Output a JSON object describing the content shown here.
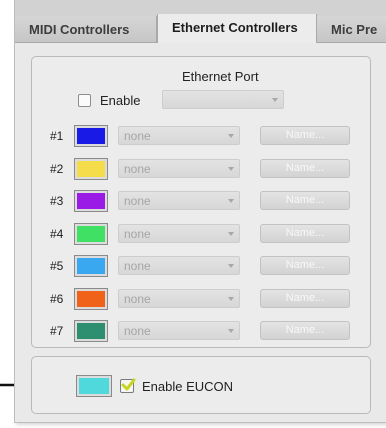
{
  "tabs": [
    {
      "label": "MIDI Controllers",
      "active": false
    },
    {
      "label": "Ethernet Controllers",
      "active": true
    },
    {
      "label": "Mic Pre",
      "active": false
    }
  ],
  "ethernet_port": {
    "label": "Ethernet Port",
    "enable_label": "Enable",
    "enable_checked": false,
    "selected_value": ""
  },
  "controllers": [
    {
      "number": "#1",
      "color": "#1a1ae6",
      "device": "none",
      "name_button": "Name..."
    },
    {
      "number": "#2",
      "color": "#f5dc4a",
      "device": "none",
      "name_button": "Name..."
    },
    {
      "number": "#3",
      "color": "#9a1ae6",
      "device": "none",
      "name_button": "Name..."
    },
    {
      "number": "#4",
      "color": "#3fe064",
      "device": "none",
      "name_button": "Name..."
    },
    {
      "number": "#5",
      "color": "#3aa8f0",
      "device": "none",
      "name_button": "Name..."
    },
    {
      "number": "#6",
      "color": "#f0621a",
      "device": "none",
      "name_button": "Name..."
    },
    {
      "number": "#7",
      "color": "#2e8f70",
      "device": "none",
      "name_button": "Name..."
    }
  ],
  "eucon": {
    "label": "Enable EUCON",
    "checked": true,
    "color": "#4fd9dc",
    "check_color": "#c6d61e"
  }
}
